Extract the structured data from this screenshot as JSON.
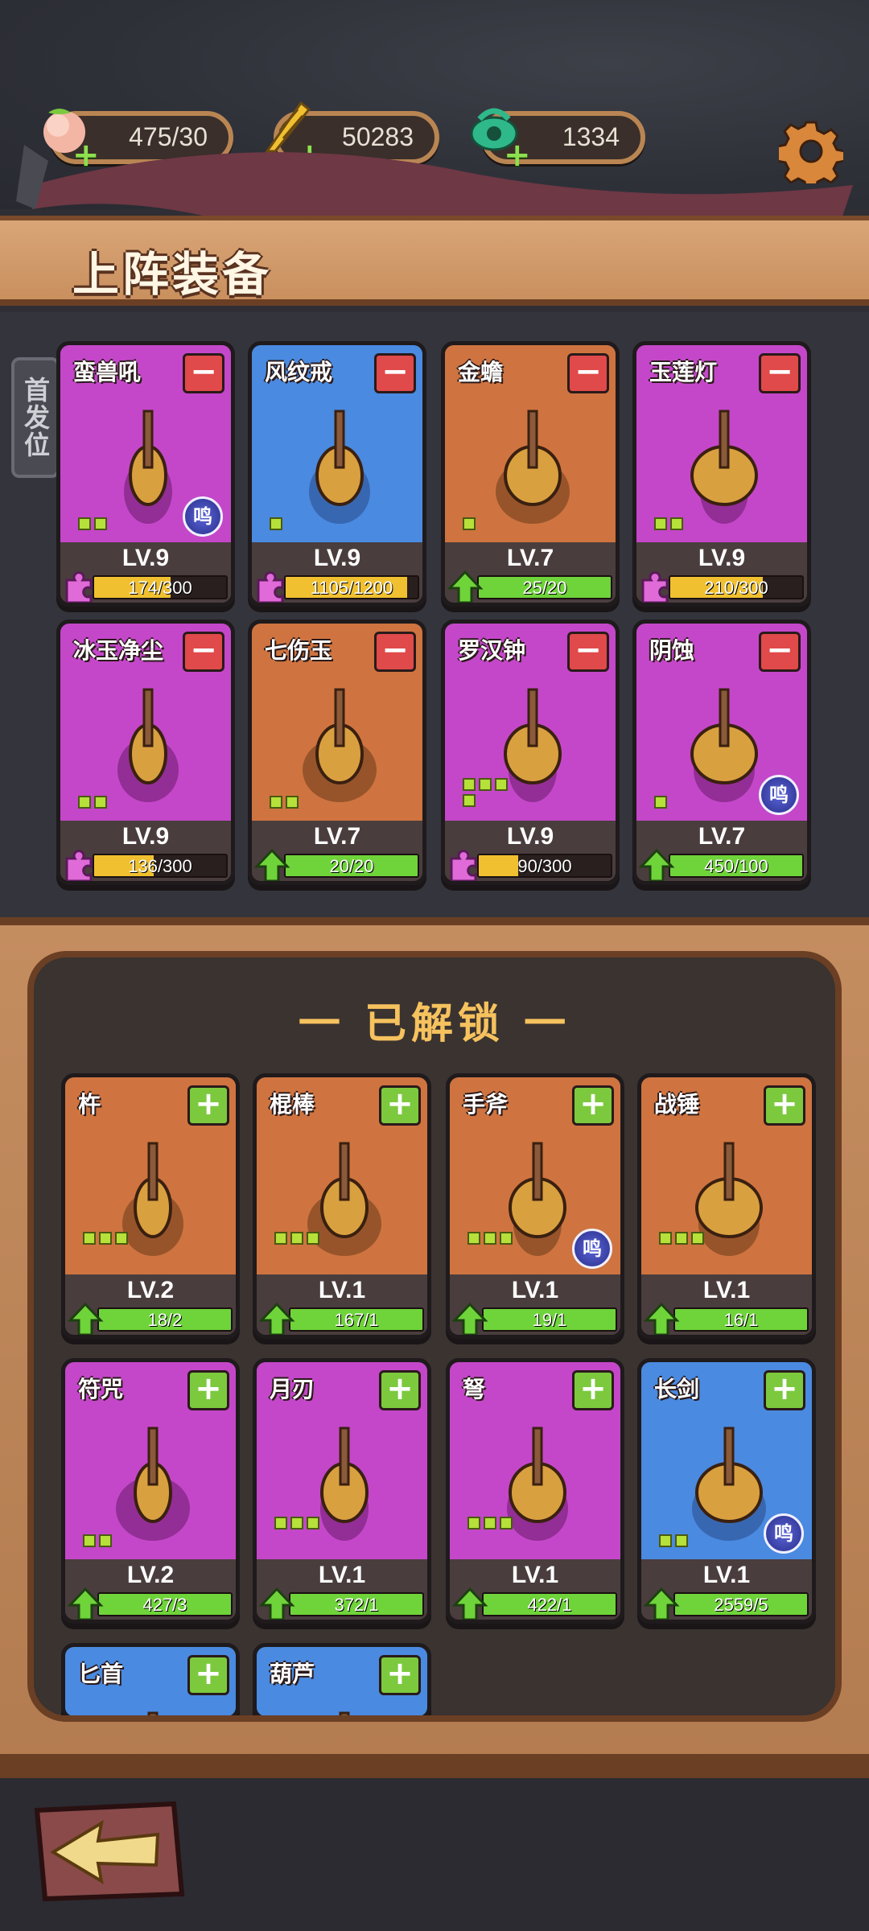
{
  "resources": [
    {
      "name": "peach",
      "icon": "peach-icon",
      "value": "475/30"
    },
    {
      "name": "gold",
      "icon": "gold-feather-icon",
      "value": "50283"
    },
    {
      "name": "jade",
      "icon": "jade-icon",
      "value": "1334"
    }
  ],
  "equipped": {
    "title": "上阵装备",
    "side_tab": "首发位",
    "cards": [
      {
        "name": "蛮兽吼",
        "rarity": "purple",
        "level": "LV.9",
        "progress": "174/300",
        "progress_fraction": 0.58,
        "bar": "yellow",
        "badge": "puzzle",
        "ming": true,
        "ming_label": "鸣",
        "pips": 2
      },
      {
        "name": "风纹戒",
        "rarity": "blue",
        "level": "LV.9",
        "progress": "1105/1200",
        "progress_fraction": 0.92,
        "bar": "yellow",
        "badge": "puzzle",
        "ming": false,
        "pips": 1
      },
      {
        "name": "金蟾",
        "rarity": "orange",
        "level": "LV.7",
        "progress": "25/20",
        "progress_fraction": 1.0,
        "bar": "green",
        "badge": "arrow",
        "ming": false,
        "pips": 1
      },
      {
        "name": "玉莲灯",
        "rarity": "purple",
        "level": "LV.9",
        "progress": "210/300",
        "progress_fraction": 0.7,
        "bar": "yellow",
        "badge": "puzzle",
        "ming": false,
        "pips": 2
      },
      {
        "name": "冰玉净尘",
        "rarity": "purple",
        "level": "LV.9",
        "progress": "136/300",
        "progress_fraction": 0.45,
        "bar": "yellow",
        "badge": "puzzle",
        "ming": false,
        "pips": 2
      },
      {
        "name": "七伤玉",
        "rarity": "orange",
        "level": "LV.7",
        "progress": "20/20",
        "progress_fraction": 1.0,
        "bar": "green",
        "badge": "arrow",
        "ming": false,
        "pips": 2
      },
      {
        "name": "罗汉钟",
        "rarity": "purple",
        "level": "LV.9",
        "progress": "90/300",
        "progress_fraction": 0.3,
        "bar": "yellow",
        "badge": "puzzle",
        "ming": false,
        "pips": 4
      },
      {
        "name": "阴蚀",
        "rarity": "purple",
        "level": "LV.7",
        "progress": "450/100",
        "progress_fraction": 1.0,
        "bar": "green",
        "badge": "arrow",
        "ming": true,
        "ming_label": "鸣",
        "pips": 1
      }
    ]
  },
  "unlocked": {
    "title": "一 已解锁 一",
    "cards": [
      {
        "name": "杵",
        "rarity": "orange",
        "level": "LV.2",
        "progress": "18/2",
        "progress_fraction": 1.0,
        "bar": "green",
        "badge": "arrow",
        "ming": false,
        "pips": 3
      },
      {
        "name": "棍棒",
        "rarity": "orange",
        "level": "LV.1",
        "progress": "167/1",
        "progress_fraction": 1.0,
        "bar": "green",
        "badge": "arrow",
        "ming": false,
        "pips": 3
      },
      {
        "name": "手斧",
        "rarity": "orange",
        "level": "LV.1",
        "progress": "19/1",
        "progress_fraction": 1.0,
        "bar": "green",
        "badge": "arrow",
        "ming": true,
        "ming_label": "鸣",
        "pips": 3
      },
      {
        "name": "战锤",
        "rarity": "orange",
        "level": "LV.1",
        "progress": "16/1",
        "progress_fraction": 1.0,
        "bar": "green",
        "badge": "arrow",
        "ming": false,
        "pips": 3
      },
      {
        "name": "符咒",
        "rarity": "purple",
        "level": "LV.2",
        "progress": "427/3",
        "progress_fraction": 1.0,
        "bar": "green",
        "badge": "arrow",
        "ming": false,
        "pips": 2
      },
      {
        "name": "月刃",
        "rarity": "purple",
        "level": "LV.1",
        "progress": "372/1",
        "progress_fraction": 1.0,
        "bar": "green",
        "badge": "arrow",
        "ming": false,
        "pips": 3
      },
      {
        "name": "弩",
        "rarity": "purple",
        "level": "LV.1",
        "progress": "422/1",
        "progress_fraction": 1.0,
        "bar": "green",
        "badge": "arrow",
        "ming": false,
        "pips": 3
      },
      {
        "name": "长剑",
        "rarity": "blue",
        "level": "LV.1",
        "progress": "2559/5",
        "progress_fraction": 1.0,
        "bar": "green",
        "badge": "arrow",
        "ming": true,
        "ming_label": "鸣",
        "pips": 2
      },
      {
        "name": "匕首",
        "rarity": "blue",
        "partial": true
      },
      {
        "name": "葫芦",
        "rarity": "blue",
        "partial": true
      }
    ]
  },
  "colors": {
    "purple": "#c447c9",
    "blue": "#4a8ae0",
    "orange": "#cf7440",
    "accent_gold": "#f6c25e"
  }
}
